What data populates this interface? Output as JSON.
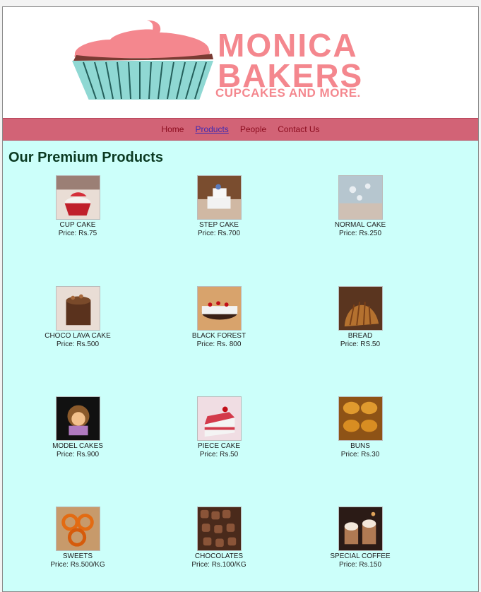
{
  "brand": {
    "line1": "MONICA",
    "line2": "BAKERS",
    "tagline": "CUPCAKES AND MORE."
  },
  "nav": {
    "items": [
      "Home",
      "Products",
      "People",
      "Contact Us"
    ],
    "active": "Products"
  },
  "page_title": "Our Premium Products",
  "products": [
    {
      "name": "CUP CAKE",
      "price": "Price: Rs.75",
      "icon": "cupcake-image"
    },
    {
      "name": "STEP CAKE",
      "price": "Price: Rs.700",
      "icon": "step-cake-image"
    },
    {
      "name": "NORMAL CAKE",
      "price": "Price: Rs.250",
      "icon": "normal-cake-image"
    },
    {
      "name": "CHOCO LAVA CAKE",
      "price": "Price: Rs.500",
      "icon": "choco-lava-cake-image"
    },
    {
      "name": "BLACK FOREST",
      "price": "Price: Rs. 800",
      "icon": "black-forest-image"
    },
    {
      "name": "BREAD",
      "price": "Price: RS.50",
      "icon": "bread-image"
    },
    {
      "name": "MODEL CAKES",
      "price": "Price: Rs.900",
      "icon": "model-cake-image"
    },
    {
      "name": "PIECE CAKE",
      "price": "Price: Rs.50",
      "icon": "piece-cake-image"
    },
    {
      "name": "BUNS",
      "price": "Price: Rs.30",
      "icon": "buns-image"
    },
    {
      "name": "SWEETS",
      "price": "Price: Rs.500/KG",
      "icon": "sweets-image"
    },
    {
      "name": "CHOCOLATES",
      "price": "Price: Rs.100/KG",
      "icon": "chocolates-image"
    },
    {
      "name": "SPECIAL COFFEE",
      "price": "Price: Rs.150",
      "icon": "special-coffee-image"
    }
  ],
  "colors": {
    "brand_pink": "#f4878e",
    "cupcake_base": "#8fd8d3",
    "nav_bg": "#d26376",
    "page_bg": "#ccfffa"
  }
}
